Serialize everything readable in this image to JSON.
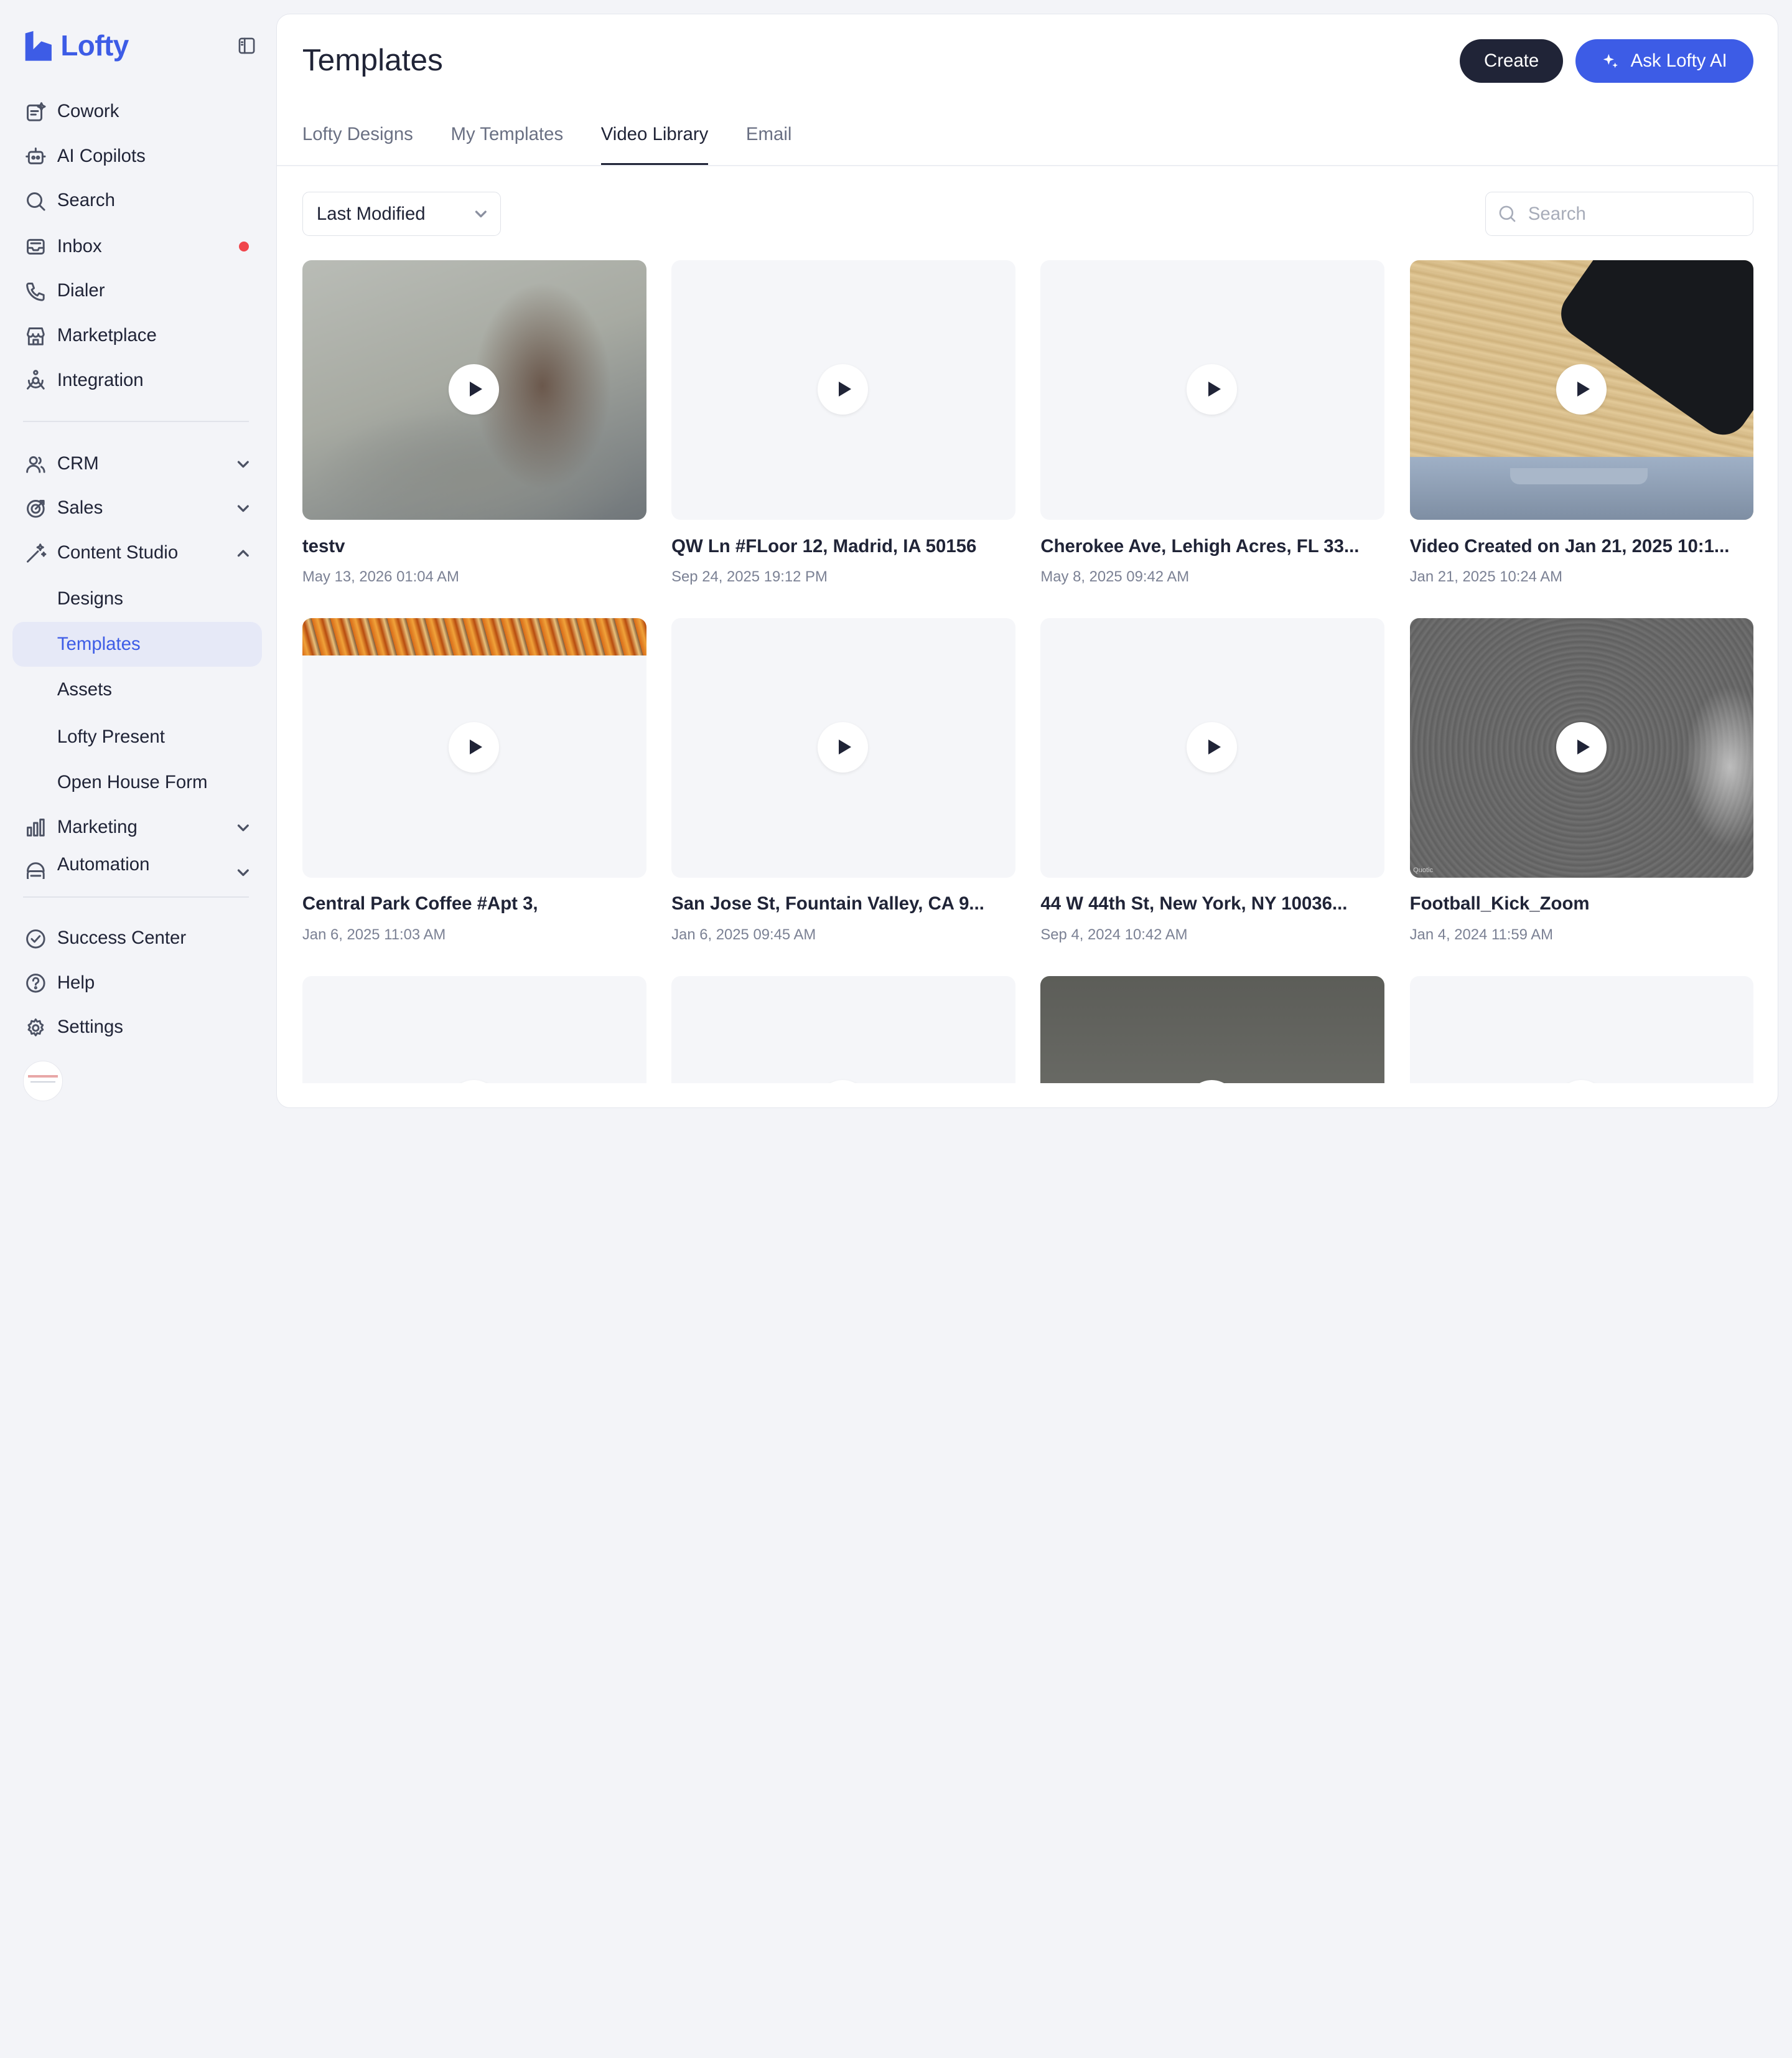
{
  "app": {
    "name": "Lofty",
    "brand_color": "#3d5ce6",
    "text_color": "#202437",
    "badge_color": "#f0454c"
  },
  "sidebar": {
    "primary": [
      {
        "label": "Cowork",
        "icon": "cowork-icon"
      },
      {
        "label": "AI Copilots",
        "icon": "robot-icon"
      },
      {
        "label": "Search",
        "icon": "search-icon"
      },
      {
        "label": "Inbox",
        "icon": "inbox-icon",
        "has_unread_dot": true
      },
      {
        "label": "Dialer",
        "icon": "phone-icon"
      },
      {
        "label": "Marketplace",
        "icon": "store-icon"
      },
      {
        "label": "Integration",
        "icon": "integration-icon"
      }
    ],
    "sections": [
      {
        "label": "CRM",
        "icon": "users-icon",
        "expanded": false
      },
      {
        "label": "Sales",
        "icon": "target-icon",
        "expanded": false
      },
      {
        "label": "Content Studio",
        "icon": "magic-wand-icon",
        "expanded": true,
        "children": [
          "Designs",
          "Templates",
          "Assets",
          "Lofty Present",
          "Open House Form"
        ],
        "active_child": "Templates"
      },
      {
        "label": "Marketing",
        "icon": "bar-chart-icon",
        "expanded": false
      },
      {
        "label": "Automation",
        "icon": "automation-icon",
        "expanded": false
      }
    ],
    "footer": [
      {
        "label": "Success Center",
        "icon": "check-circle-icon"
      },
      {
        "label": "Help",
        "icon": "help-icon"
      },
      {
        "label": "Settings",
        "icon": "gear-icon"
      }
    ]
  },
  "page": {
    "title": "Templates",
    "create_label": "Create",
    "ask_ai_label": "Ask Lofty AI",
    "tabs": [
      "Lofty Designs",
      "My Templates",
      "Video Library",
      "Email"
    ],
    "active_tab": "Video Library",
    "sort": {
      "selected": "Last Modified"
    },
    "search": {
      "placeholder": "Search",
      "value": ""
    }
  },
  "videos": [
    {
      "title": "testv",
      "date": "May 13, 2026 01:04 AM",
      "thumbnail": "blurred-office"
    },
    {
      "title": "QW Ln #FLoor 12, Madrid, IA 50156",
      "date": "Sep 24, 2025 19:12 PM",
      "thumbnail": "blank"
    },
    {
      "title": "Cherokee Ave, Lehigh Acres, FL 33...",
      "date": "May 8, 2025 09:42 AM",
      "thumbnail": "blank"
    },
    {
      "title": "Video Created on Jan 21, 2025 10:1...",
      "date": "Jan 21, 2025 10:24 AM",
      "thumbnail": "desk-phone"
    },
    {
      "title": "Central Park Coffee #Apt 3,",
      "date": "Jan 6, 2025 11:03 AM",
      "thumbnail": "autumn-trees"
    },
    {
      "title": "San Jose St, Fountain Valley, CA 9...",
      "date": "Jan 6, 2025 09:45 AM",
      "thumbnail": "blank"
    },
    {
      "title": "44 W 44th St, New York, NY 10036...",
      "date": "Sep 4, 2024 10:42 AM",
      "thumbnail": "blank"
    },
    {
      "title": "Football_Kick_Zoom",
      "date": "Jan 4, 2024 11:59 AM",
      "thumbnail": "grass-field",
      "watermark": "Quotic"
    },
    {
      "title": "",
      "date": "",
      "thumbnail": "blank"
    },
    {
      "title": "",
      "date": "",
      "thumbnail": "blank"
    },
    {
      "title": "",
      "date": "",
      "thumbnail": "dark-room"
    },
    {
      "title": "",
      "date": "",
      "thumbnail": "blank"
    }
  ]
}
